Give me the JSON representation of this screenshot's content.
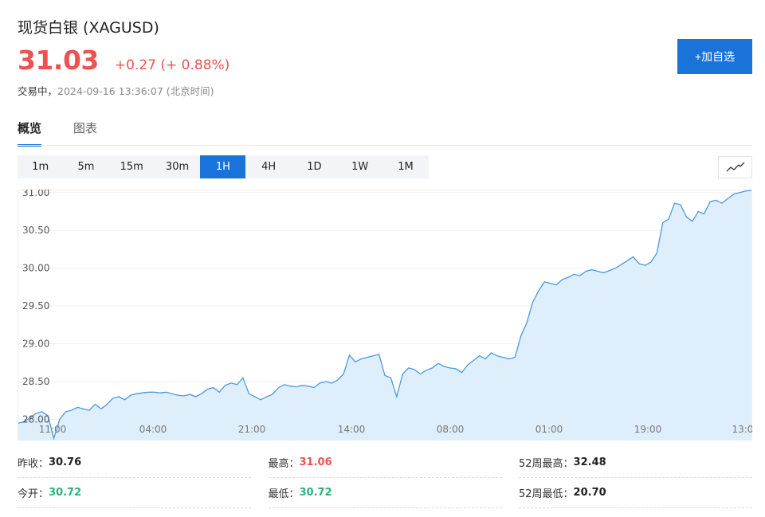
{
  "header": {
    "title": "现货白银 (XAGUSD)",
    "price": "31.03",
    "change": "+0.27 (+ 0.88%)",
    "status": "交易中，",
    "timestamp": "2024-09-16 13:36:07 (北京时间)",
    "add_button": "+加自选"
  },
  "tabs": [
    {
      "label": "概览",
      "active": true
    },
    {
      "label": "图表",
      "active": false
    }
  ],
  "periods": [
    {
      "label": "1m"
    },
    {
      "label": "5m"
    },
    {
      "label": "15m"
    },
    {
      "label": "30m"
    },
    {
      "label": "1H",
      "active": true
    },
    {
      "label": "4H"
    },
    {
      "label": "1D"
    },
    {
      "label": "1W"
    },
    {
      "label": "1M"
    }
  ],
  "chart_toggle_icon": "line-chart-icon",
  "colors": {
    "up": "#f05050",
    "down": "#26b37e",
    "accent": "#1a73d9",
    "area": "#dcecfb",
    "line": "#4a9ae0"
  },
  "chart_data": {
    "type": "area",
    "ylim": [
      27.72,
      31.04
    ],
    "yticks": [
      "31.00",
      "30.50",
      "30.00",
      "29.50",
      "29.00",
      "28.50",
      "28.00"
    ],
    "xticks": [
      "11:00",
      "04:00",
      "21:00",
      "14:00",
      "08:00",
      "01:00",
      "19:00",
      "13:0"
    ],
    "values": [
      27.95,
      27.97,
      28.02,
      28.08,
      28.1,
      28.05,
      27.75,
      28.0,
      28.1,
      28.12,
      28.16,
      28.14,
      28.12,
      28.2,
      28.14,
      28.2,
      28.28,
      28.3,
      28.26,
      28.32,
      28.34,
      28.35,
      28.36,
      28.36,
      28.35,
      28.36,
      28.34,
      28.32,
      28.31,
      28.33,
      28.3,
      28.34,
      28.4,
      28.42,
      28.36,
      28.45,
      28.48,
      28.46,
      28.55,
      28.34,
      28.3,
      28.26,
      28.3,
      28.33,
      28.42,
      28.46,
      28.44,
      28.43,
      28.45,
      28.44,
      28.42,
      28.48,
      28.5,
      28.48,
      28.52,
      28.6,
      28.85,
      28.76,
      28.8,
      28.82,
      28.84,
      28.86,
      28.58,
      28.55,
      28.3,
      28.6,
      28.68,
      28.66,
      28.6,
      28.65,
      28.68,
      28.74,
      28.7,
      28.68,
      28.67,
      28.62,
      28.72,
      28.78,
      28.84,
      28.8,
      28.88,
      28.84,
      28.82,
      28.8,
      28.82,
      29.1,
      29.28,
      29.55,
      29.7,
      29.82,
      29.8,
      29.78,
      29.85,
      29.88,
      29.92,
      29.9,
      29.96,
      29.98,
      29.96,
      29.94,
      29.97,
      30.0,
      30.05,
      30.1,
      30.15,
      30.06,
      30.04,
      30.08,
      30.2,
      30.6,
      30.65,
      30.86,
      30.84,
      30.68,
      30.62,
      30.75,
      30.72,
      30.88,
      30.9,
      30.86,
      30.92,
      30.98,
      31.0,
      31.02,
      31.03
    ]
  },
  "stats": [
    [
      {
        "label": "昨收：",
        "value": "30.76",
        "tone": "neutral"
      },
      {
        "label": "最高：",
        "value": "31.06",
        "tone": "up"
      },
      {
        "label": "52周最高：",
        "value": "32.48",
        "tone": "neutral"
      }
    ],
    [
      {
        "label": "今开：",
        "value": "30.72",
        "tone": "down"
      },
      {
        "label": "最低：",
        "value": "30.72",
        "tone": "down"
      },
      {
        "label": "52周最低：",
        "value": "20.70",
        "tone": "neutral"
      }
    ]
  ]
}
